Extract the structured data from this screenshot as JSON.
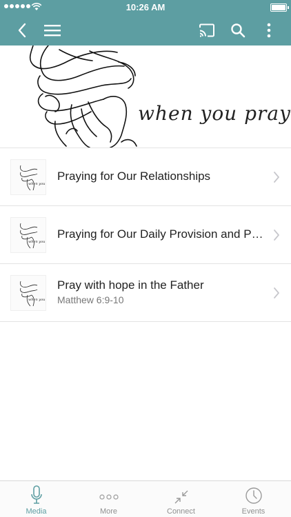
{
  "status_bar": {
    "time": "10:26 AM"
  },
  "nav": {
    "back_icon": "chevron-left-icon",
    "menu_icon": "hamburger-icon",
    "cast_icon": "cast-icon",
    "search_icon": "search-icon",
    "more_icon": "vertical-dots-icon"
  },
  "hero": {
    "caption": "when you pray"
  },
  "items": [
    {
      "title": "Praying for Our Relationships",
      "subtitle": ""
    },
    {
      "title": "Praying for Our Daily Provision and Pr…",
      "subtitle": ""
    },
    {
      "title": "Pray with hope in the Father",
      "subtitle": "Matthew 6:9-10"
    }
  ],
  "tabs": [
    {
      "label": "Media",
      "icon": "microphone-icon",
      "active": true
    },
    {
      "label": "More",
      "icon": "ellipsis-icon",
      "active": false
    },
    {
      "label": "Connect",
      "icon": "connect-arrows-icon",
      "active": false
    },
    {
      "label": "Events",
      "icon": "clock-icon",
      "active": false
    }
  ],
  "colors": {
    "accent": "#5d9ea2",
    "tab_inactive": "#8f8f8f"
  }
}
